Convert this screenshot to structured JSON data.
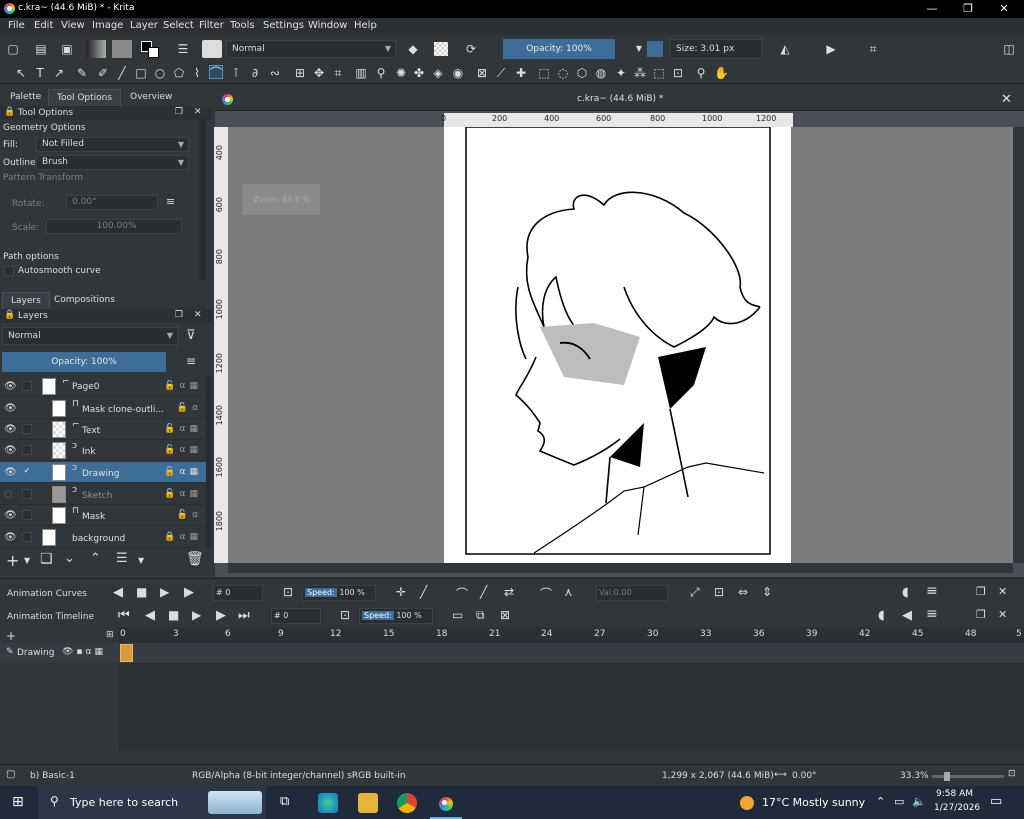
{
  "window": {
    "title": "c.kra~ (44.6 MiB) * - Krita"
  },
  "menu": [
    "File",
    "Edit",
    "View",
    "Image",
    "Layer",
    "Select",
    "Filter",
    "Tools",
    "Settings",
    "Window",
    "Help"
  ],
  "toolbar": {
    "blend_mode": "Normal",
    "opacity": "Opacity: 100%",
    "size": "Size: 3.01 px"
  },
  "dock_tabs": {
    "palette": "Palette",
    "tool_options": "Tool Options",
    "overview": "Overview"
  },
  "tool_options": {
    "header": "Tool Options",
    "geometry": "Geometry Options",
    "fill_label": "Fill:",
    "fill_value": "Not Filled",
    "outline_label": "Outline:",
    "outline_value": "Brush",
    "pattern": "Pattern Transform",
    "rotate_label": "Rotate:",
    "rotate_value": "0.00°",
    "scale_label": "Scale:",
    "scale_value": "100.00%",
    "path_options": "Path options",
    "autosmooth": "Autosmooth curve"
  },
  "layer_tabs": {
    "layers": "Layers",
    "compositions": "Compositions"
  },
  "layers": {
    "header": "Layers",
    "blend": "Normal",
    "opacity": "Opacity:  100%",
    "items": [
      {
        "name": "Page0"
      },
      {
        "name": "Mask clone-outli..."
      },
      {
        "name": "Text"
      },
      {
        "name": "Ink"
      },
      {
        "name": "Drawing"
      },
      {
        "name": "Sketch"
      },
      {
        "name": "Mask"
      },
      {
        "name": "background"
      }
    ]
  },
  "document": {
    "tab_title": "c.kra~ (44.6 MiB) *",
    "zoom_hint": "Zoom: 33.3 %"
  },
  "ruler": {
    "h": [
      "0",
      "200",
      "400",
      "600",
      "800",
      "1000",
      "1200"
    ],
    "v": [
      "400",
      "600",
      "800",
      "1000",
      "1200",
      "1400",
      "1600",
      "1800"
    ]
  },
  "animation": {
    "curves_label": "Animation Curves",
    "timeline_label": "Animation Timeline",
    "frame_curves": "# 0",
    "frame_timeline": "# 0",
    "speed_label": "Speed:",
    "speed_value": "100 %",
    "value": "Val:0.00",
    "frames": [
      "0",
      "3",
      "6",
      "9",
      "12",
      "15",
      "18",
      "21",
      "24",
      "27",
      "30",
      "33",
      "36",
      "39",
      "42",
      "45",
      "48",
      "5"
    ],
    "track_name": "Drawing"
  },
  "status": {
    "brush": "b) Basic-1",
    "color": "RGB/Alpha (8-bit integer/channel)  sRGB built-in",
    "size": "1,299 x 2,067 (44.6 MiB)",
    "rotation": "0.00°",
    "zoom": "33.3%"
  },
  "taskbar": {
    "search": "Type here to search",
    "weather": "17°C  Mostly sunny",
    "time": "9:58 AM",
    "date": "1/27/2026"
  }
}
